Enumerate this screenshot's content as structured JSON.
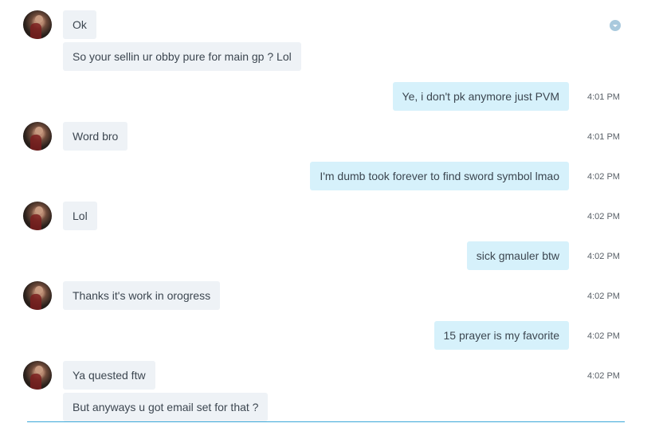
{
  "conversation": {
    "messages": [
      {
        "side": "in",
        "text": "Ok",
        "time": ""
      },
      {
        "side": "in",
        "text": "So your sellin ur obby pure for main gp ? Lol",
        "time": ""
      },
      {
        "side": "out",
        "text": "Ye, i don't pk anymore just PVM",
        "time": "4:01 PM"
      },
      {
        "side": "in",
        "text": "Word bro",
        "time": "4:01 PM"
      },
      {
        "side": "out",
        "text": "I'm dumb took forever to find sword symbol lmao",
        "time": "4:02 PM"
      },
      {
        "side": "in",
        "text": "Lol",
        "time": "4:02 PM"
      },
      {
        "side": "out",
        "text": "sick gmauler btw",
        "time": "4:02 PM"
      },
      {
        "side": "in",
        "text": "Thanks it's work in orogress",
        "time": "4:02 PM"
      },
      {
        "side": "out",
        "text": "15 prayer is my favorite",
        "time": "4:02 PM"
      },
      {
        "side": "in",
        "text": "Ya quested ftw",
        "time": "4:02 PM"
      },
      {
        "side": "in",
        "text": "But anyways u got email set for that ?",
        "time": ""
      }
    ]
  },
  "icons": {
    "scroll_indicator": "chevron-down-icon",
    "avatar": "contact-avatar"
  },
  "colors": {
    "incoming_bubble": "#eef2f6",
    "outgoing_bubble": "#d6f1fb",
    "text": "#3c4650",
    "timestamp": "#5a6168",
    "divider": "#3aa7d8",
    "indicator": "#a9c9dd"
  }
}
